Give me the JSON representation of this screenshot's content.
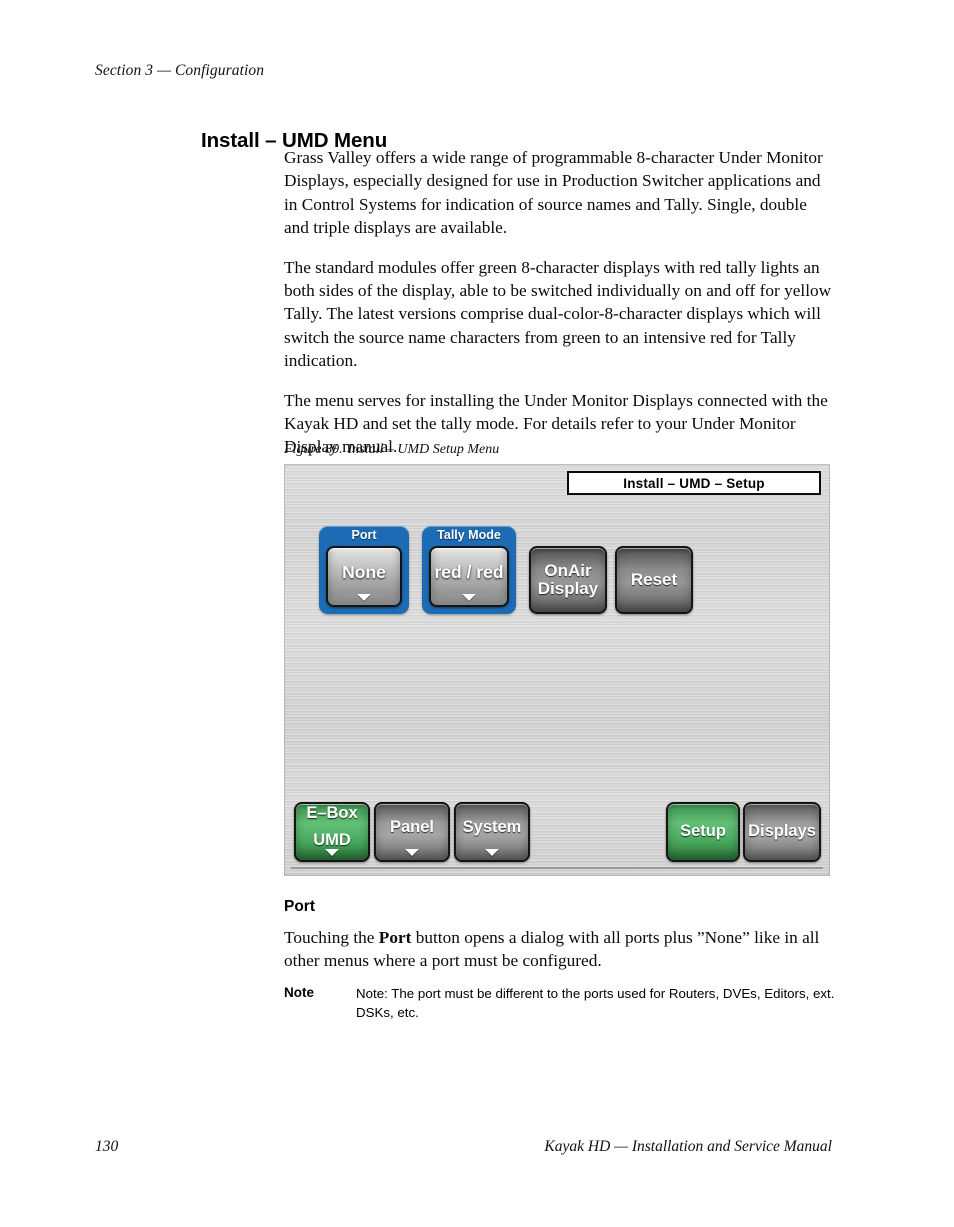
{
  "page": {
    "running_header": "Section 3 — Configuration",
    "section_heading": "Install – UMD Menu",
    "footer_page_number": "130",
    "footer_title": "Kayak HD  —  Installation and Service Manual"
  },
  "body": {
    "paragraph_1": "Grass Valley offers a wide range of programmable 8-character Under Monitor Displays, especially designed for use in Production Switcher applications and in Control Systems for indication of source names and Tally. Single, double and triple displays are available.",
    "paragraph_2": "The standard modules offer green 8-character displays with red tally lights an both sides of the display, able to be switched individually on and off for yellow Tally. The latest versions comprise dual-color-8-character displays which will switch the source name characters from green to an intensive red for Tally indication.",
    "paragraph_3": "The menu serves for installing the Under Monitor Displays connected with the Kayak HD and set the tally mode. For details refer to your Under Monitor Display manual."
  },
  "figure": {
    "caption_number": "Figure 89.",
    "caption_text": "Install – UMD Setup Menu",
    "menu_title": "Install – UMD – Setup",
    "param_groups": [
      {
        "label": "Port",
        "value": "None",
        "caret": "chevron-down-icon"
      },
      {
        "label": "Tally Mode",
        "value": "red / red",
        "caret": "chevron-down-icon"
      }
    ],
    "action_buttons": [
      {
        "line1": "OnAir",
        "line2": "Display"
      },
      {
        "line1": "Reset",
        "line2": ""
      }
    ],
    "nav_left": [
      {
        "line1": "E–Box",
        "line2": "UMD",
        "selected": true,
        "caret": true
      },
      {
        "line1": "Panel",
        "line2": "",
        "selected": false,
        "caret": true
      },
      {
        "line1": "System",
        "line2": "",
        "selected": false,
        "caret": true
      }
    ],
    "nav_right": [
      {
        "line1": "Setup",
        "selected": true
      },
      {
        "line1": "Displays",
        "selected": false
      }
    ],
    "colors": {
      "group_blue": "#1c6bb4",
      "selected_green": "#52b268",
      "panel_silver": "#d4d4d4",
      "button_text": "#ffffff"
    }
  },
  "port_section": {
    "heading": "Port",
    "text_before_bold": "Touching the ",
    "bold_word": "Port",
    "text_after_bold": " button opens a dialog with all ports plus ”None” like in all other menus where a port must be configured.",
    "note_label": "Note",
    "note_text": "Note: The port must be different to the ports used for Routers, DVEs, Editors, ext. DSKs, etc."
  }
}
